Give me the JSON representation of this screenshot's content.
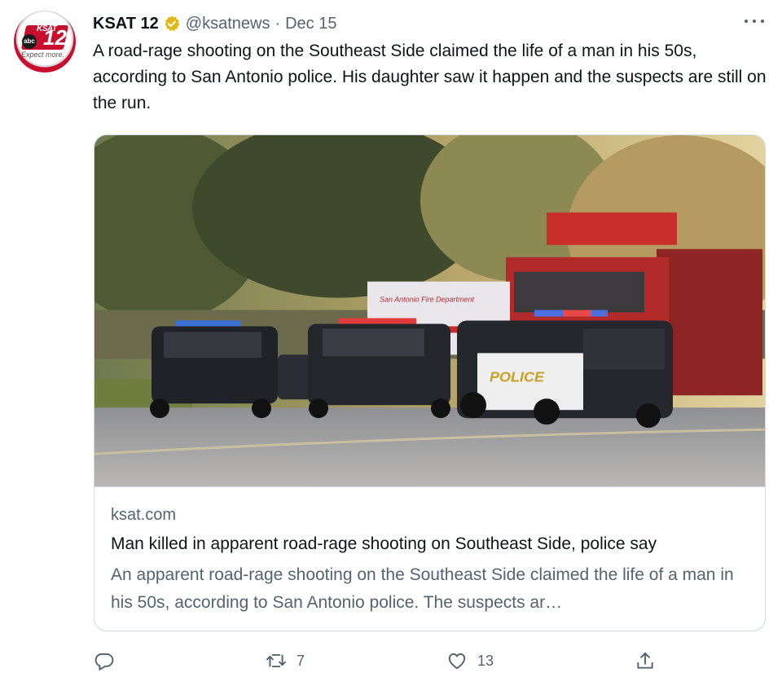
{
  "tweet": {
    "author_name": "KSAT 12",
    "author_handle": "@ksatnews",
    "separator": "·",
    "date": "Dec 15",
    "text": "A road-rage shooting on the Southeast Side claimed the life of a man in his 50s, according to San Antonio police. His daughter saw it happen and the suspects are still on the run.",
    "avatar_text": {
      "brand": "KSAT",
      "number": "12",
      "network": "abc",
      "tagline": "Expect more."
    },
    "image_text": {
      "vehicle_label": "POLICE",
      "truck_label": "San Antonio Fire Department"
    }
  },
  "card": {
    "domain": "ksat.com",
    "title": "Man killed in apparent road-rage shooting on Southeast Side, police say",
    "description": "An apparent road-rage shooting on the Southeast Side claimed the life of a man in his 50s, according to San Antonio police. The suspects ar…"
  },
  "actions": {
    "retweet_count": "7",
    "like_count": "13"
  },
  "colors": {
    "text_primary": "#0f1419",
    "text_secondary": "#536471",
    "border": "#cfd9de",
    "verified_gold": "#e2b719"
  },
  "icons": [
    "more-icon",
    "verified-badge-icon",
    "reply-icon",
    "retweet-icon",
    "like-icon",
    "share-icon"
  ]
}
